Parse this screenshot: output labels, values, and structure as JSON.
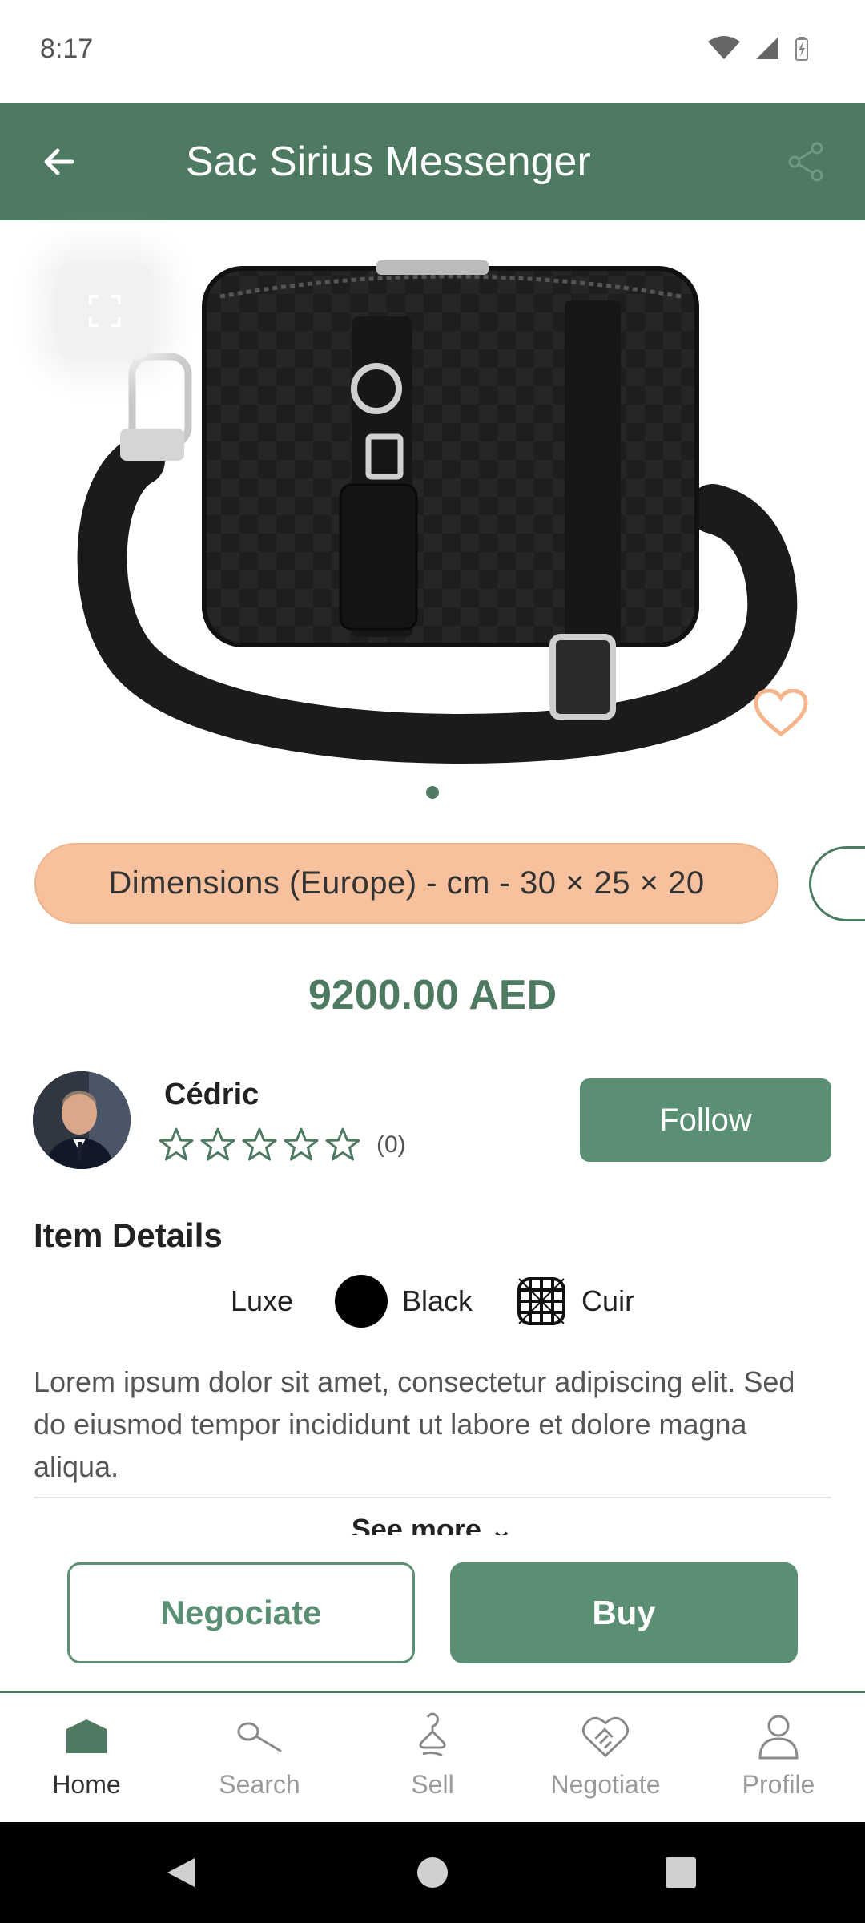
{
  "status_bar": {
    "time": "8:17"
  },
  "app_bar": {
    "title": "Sac Sirius Messenger"
  },
  "product": {
    "chip_label": "Dimensions (Europe) - cm - 30 × 25 × 20",
    "price": "9200.00 AED"
  },
  "seller": {
    "name": "Cédric",
    "rating_count": "(0)",
    "follow_label": "Follow"
  },
  "details": {
    "heading": "Item Details",
    "category": "Luxe",
    "color": "Black",
    "material": "Cuir",
    "description": "Lorem ipsum dolor sit amet, consectetur adipiscing elit. Sed do eiusmod tempor incididunt ut labore et dolore magna aliqua.",
    "see_more": "See more ⌄"
  },
  "actions": {
    "negotiate_label": "Negociate",
    "buy_label": "Buy"
  },
  "bottom_nav": {
    "items": [
      {
        "label": "Home",
        "icon": "home-icon"
      },
      {
        "label": "Search",
        "icon": "search-icon"
      },
      {
        "label": "Sell",
        "icon": "hanger-icon"
      },
      {
        "label": "Negotiate",
        "icon": "handshake-icon"
      },
      {
        "label": "Profile",
        "icon": "profile-icon"
      }
    ]
  },
  "colors": {
    "primary": "#4d7a61",
    "button": "#5a8f73",
    "chip": "#f6c19c",
    "heart": "#f5b48a",
    "bag_color": "#000000"
  }
}
